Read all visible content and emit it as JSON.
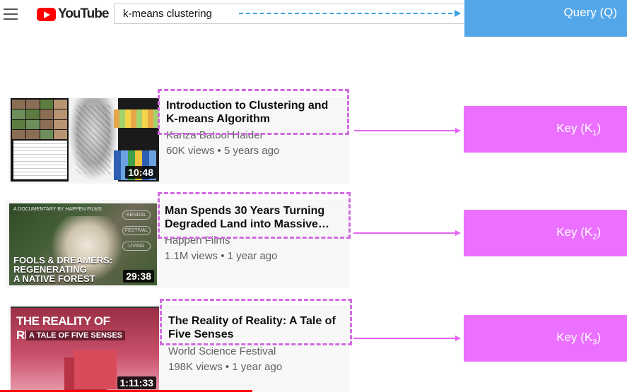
{
  "header": {
    "menu_icon": "hamburger-menu-icon",
    "logo_text": "YouTube",
    "search_value": "k-means clustering",
    "query_label": "Query (Q)"
  },
  "videos": [
    {
      "title_line1": "Introduction to Clustering and",
      "title_line2": "K-means Algorithm",
      "channel": "Kanza Batool Haider",
      "views": "60K views • 5 years ago",
      "duration": "10:48",
      "key_label": "Key (K",
      "key_sub": "1",
      "key_close": ")"
    },
    {
      "title_line1": "Man Spends 30 Years Turning",
      "title_line2": "Degraded Land into Massive…",
      "channel": "Happen Films",
      "views": "1.1M views • 1 year ago",
      "duration": "29:38",
      "key_label": "Key (K",
      "key_sub": "2",
      "key_close": ")",
      "thumb_small": "A DOCUMENTARY BY HAPPEN FILMS",
      "thumb_title1": "FOOLS & DREAMERS:",
      "thumb_title2": "REGENERATING",
      "thumb_title3": "A NATIVE FOREST",
      "laurel1": "KENDAL",
      "laurel2": "FESTIVAL",
      "laurel3": "LIVING"
    },
    {
      "title_line1": "The Reality of Reality: A Tale of",
      "title_line2": "Five Senses",
      "channel": "World Science Festival",
      "views": "198K views • 1 year ago",
      "duration": "1:11:33",
      "key_label": "Key (K",
      "key_sub": "3",
      "key_close": ")",
      "thumb_title": "THE REALITY OF REALITY:",
      "thumb_sub": "A TALE OF FIVE SENSES"
    }
  ],
  "colors": {
    "query": "#53a7e9",
    "key": "#ec70ff",
    "dash": "#d16be0",
    "youtube_red": "#ff0000"
  }
}
